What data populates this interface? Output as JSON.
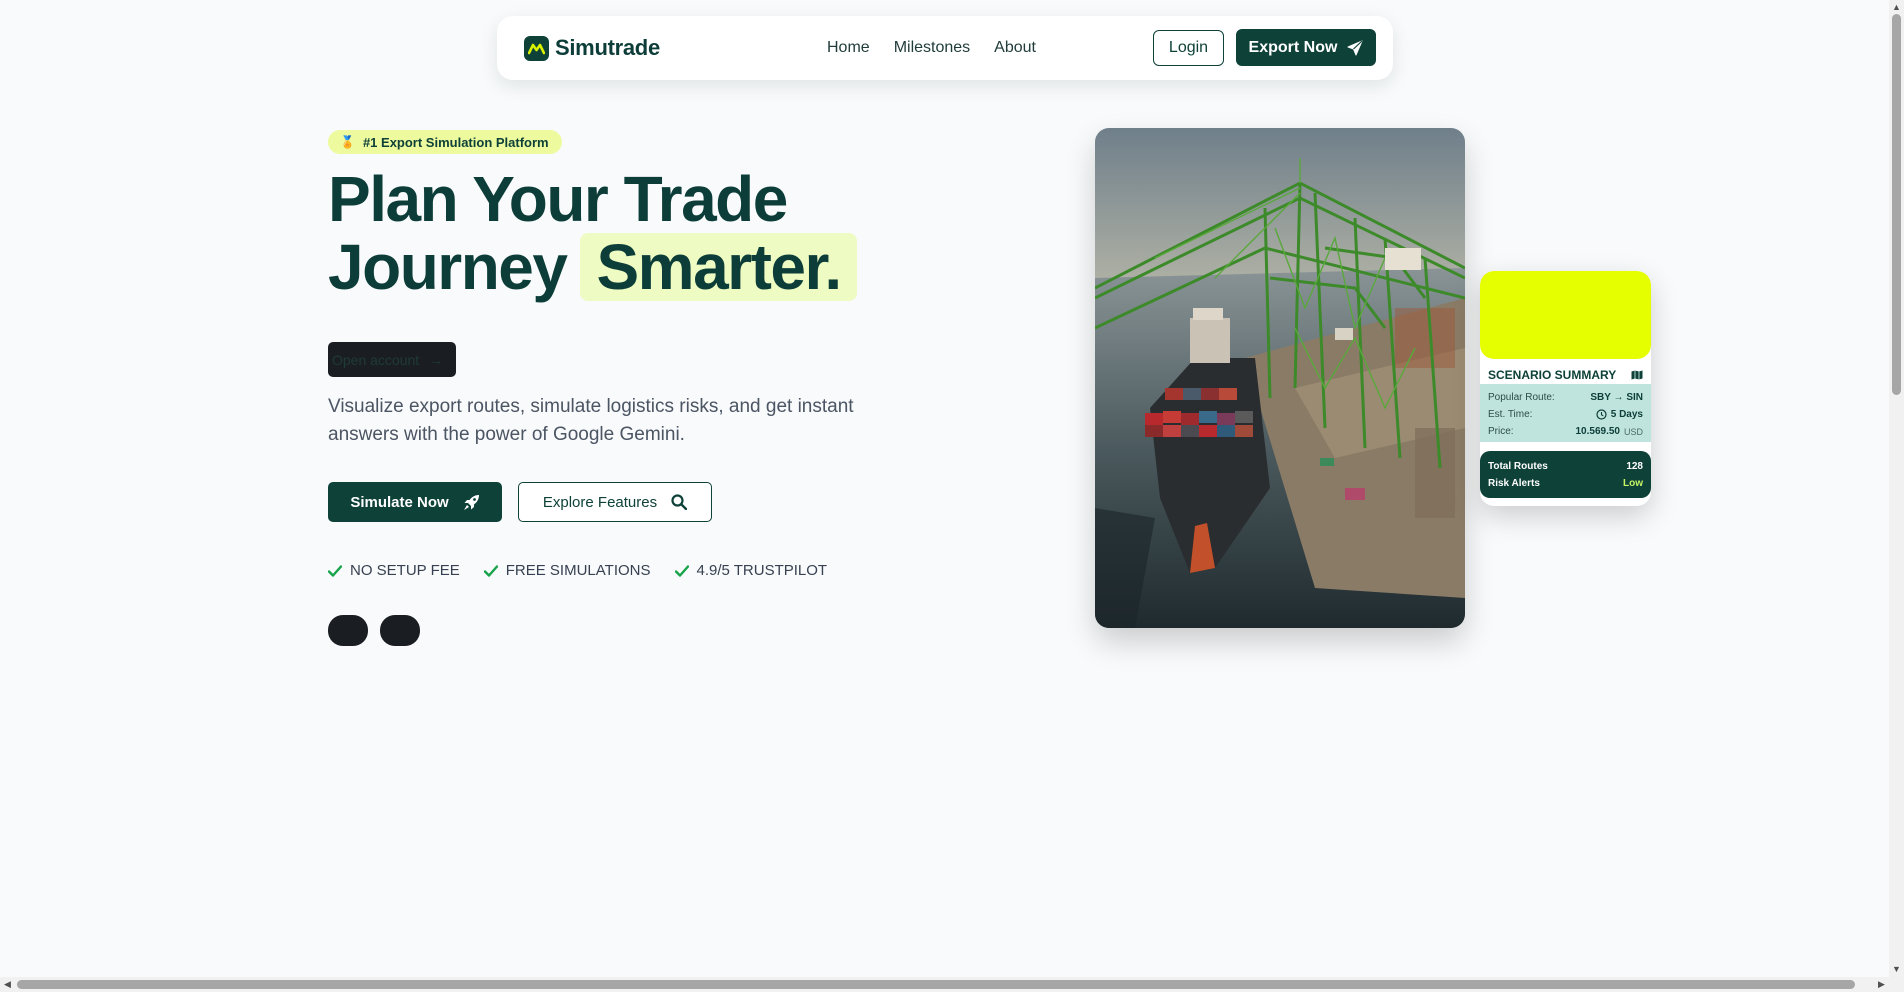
{
  "nav": {
    "brand": "Simutrade",
    "links": [
      "Home",
      "Milestones",
      "About"
    ],
    "login_label": "Login",
    "export_label": "Export Now"
  },
  "hero": {
    "badge_emoji": "🏅",
    "badge": "#1 Export Simulation Platform",
    "headline_line1": "Plan Your Trade",
    "headline_line2": "Journey",
    "headline_highlight": "Smarter.",
    "open_account_label": "Open account",
    "subtitle": "Visualize export routes, simulate logistics risks, and get instant answers with the power of Google Gemini.",
    "simulate_label": "Simulate Now",
    "explore_label": "Explore Features",
    "features": [
      "NO SETUP FEE",
      "FREE SIMULATIONS",
      "4.9/5 TRUSTPILOT"
    ]
  },
  "summary_card": {
    "title": "SCENARIO SUMMARY",
    "popular_route_label": "Popular Route:",
    "popular_route_value": "SBY → SIN",
    "est_time_label": "Est. Time:",
    "est_time_value": "5 Days",
    "price_label": "Price:",
    "price_value": "10.569.50",
    "price_unit": "USD",
    "total_routes_label": "Total Routes",
    "total_routes_value": "128",
    "risk_alerts_label": "Risk Alerts",
    "risk_alerts_value": "Low"
  },
  "colors": {
    "primary": "#0e4138",
    "lime": "#e6ff00",
    "badge_bg": "#eefa9e",
    "highlight_bg": "#eefbc2",
    "check": "#16a34a"
  },
  "icons": {
    "logo": "logo-mark-icon",
    "export": "paper-plane-icon",
    "simulate": "rocket-icon",
    "explore": "search-icon",
    "feature": "check-icon",
    "card": "map-icon",
    "time": "clock-icon"
  }
}
